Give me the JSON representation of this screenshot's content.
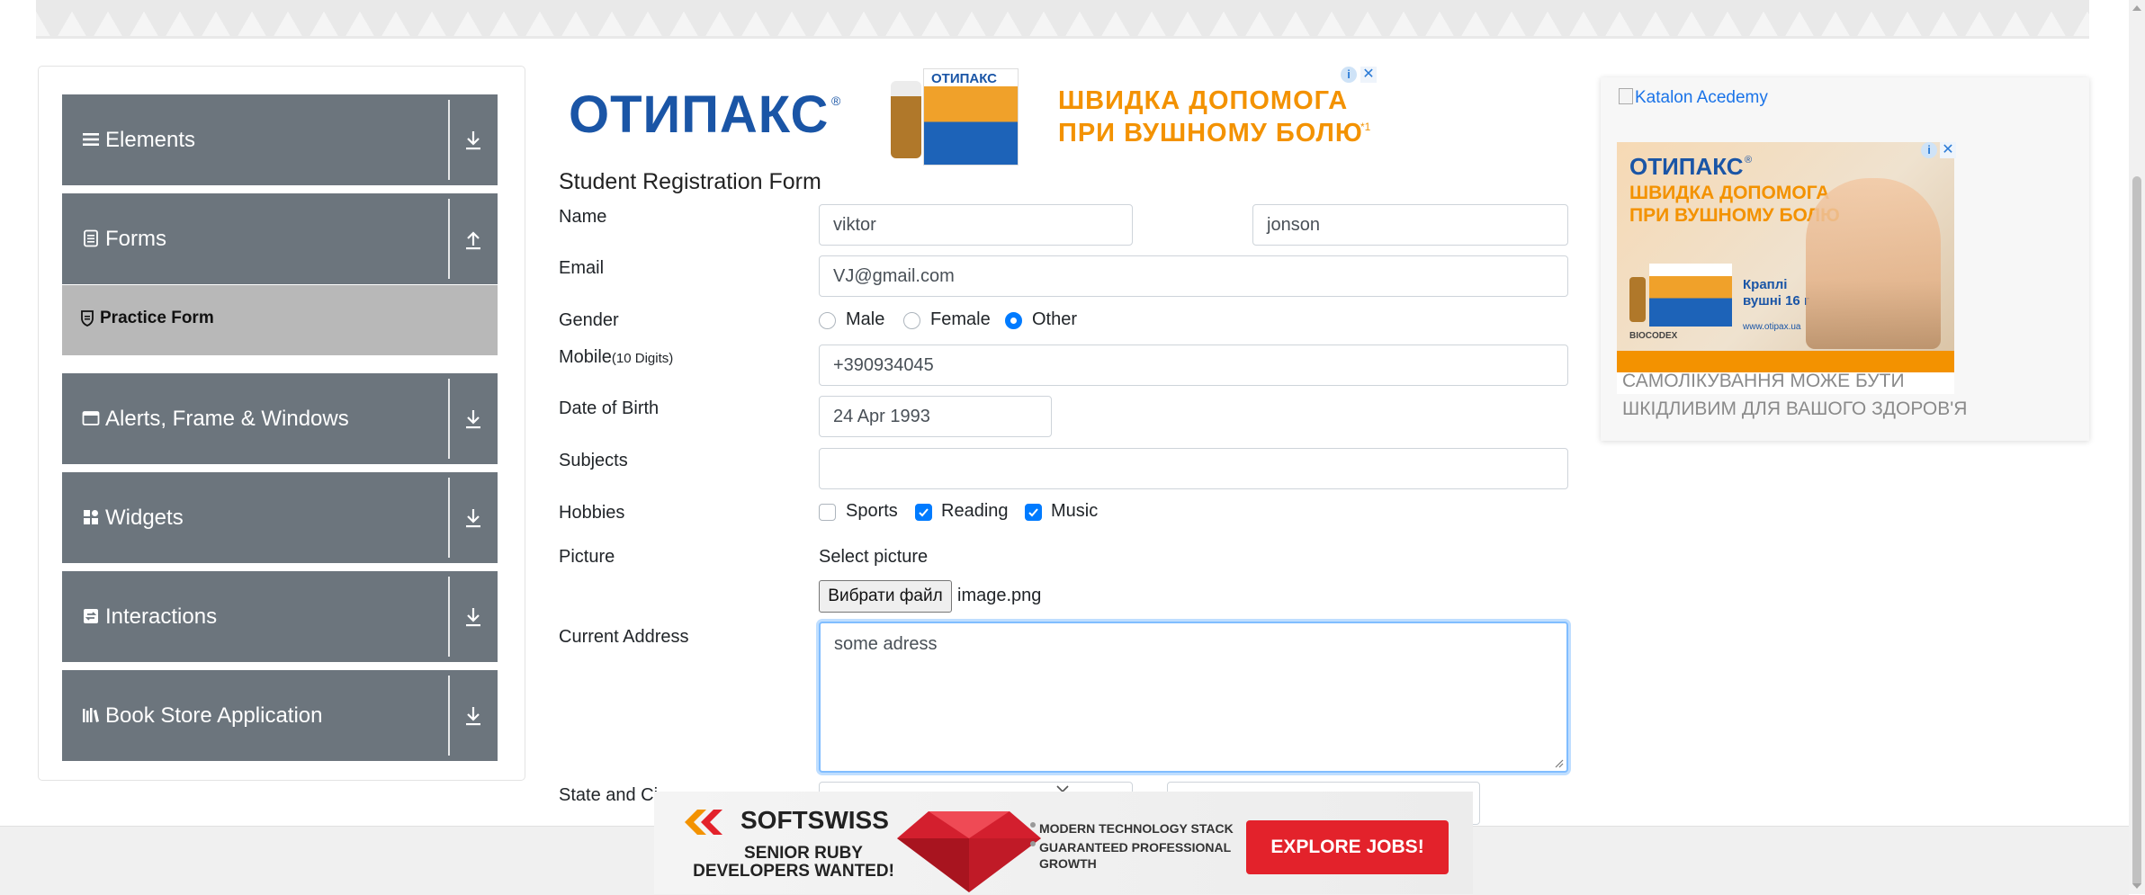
{
  "sidebar": {
    "groups": [
      {
        "label": "Elements",
        "icon": "menu-icon"
      },
      {
        "label": "Forms",
        "icon": "document-icon",
        "expanded": true
      },
      {
        "label": "Alerts, Frame & Windows",
        "icon": "window-icon"
      },
      {
        "label": "Widgets",
        "icon": "widgets-icon"
      },
      {
        "label": "Interactions",
        "icon": "interactions-icon"
      },
      {
        "label": "Book Store Application",
        "icon": "books-icon"
      }
    ],
    "active_item": {
      "label": "Practice Form",
      "icon": "shield-icon"
    }
  },
  "ad_top": {
    "brand": "ОТИПАКС",
    "trademark": "®",
    "product_label": "ОТИПАКС",
    "slogan_line1": "ШВИДКА ДОПОМОГА",
    "slogan_line2": "ПРИ ВУШНОМУ БОЛЮ",
    "slogan_mark": "*1"
  },
  "form": {
    "title": "Student Registration Form",
    "name_label": "Name",
    "first_name": "viktor",
    "last_name": "jonson",
    "email_label": "Email",
    "email": "VJ@gmail.com",
    "gender_label": "Gender",
    "genders": [
      "Male",
      "Female",
      "Other"
    ],
    "gender_selected": "Other",
    "mobile_label": "Mobile",
    "mobile_hint": "(10 Digits)",
    "mobile": "+390934045",
    "dob_label": "Date of Birth",
    "dob": "24 Apr 1993",
    "subjects_label": "Subjects",
    "subjects": "",
    "hobbies_label": "Hobbies",
    "hobbies": [
      {
        "label": "Sports",
        "checked": false
      },
      {
        "label": "Reading",
        "checked": true
      },
      {
        "label": "Music",
        "checked": true
      }
    ],
    "picture_label": "Picture",
    "select_picture": "Select picture",
    "file_button": "Вибрати файл",
    "file_name": "image.png",
    "address_label": "Current Address",
    "address": "some adress",
    "state_city_label": "State and Ci"
  },
  "right_ad": {
    "broken_image_alt": "Katalon Acedemy",
    "brand": "ОТИПАКС",
    "trademark": "®",
    "slogan_line1": "ШВИДКА ДОПОМОГА",
    "slogan_line2": "ПРИ ВУШНОМУ БОЛЮ",
    "product_line1": "Краплі",
    "product_line2": "вушні 16 г",
    "site": "www.otipax.ua",
    "company": "BIOCODEX",
    "warning_line1": "САМОЛІКУВАННЯ МОЖЕ БУТИ",
    "warning_line2": "ШКІДЛИВИМ ДЛЯ ВАШОГО ЗДОРОВ'Я"
  },
  "bottom_ad": {
    "brand": "SOFTSWISS",
    "tagline_line1": "SENIOR RUBY",
    "tagline_line2": "DEVELOPERS WANTED!",
    "bullet1": "MODERN TECHNOLOGY STACK",
    "bullet2_line1": "GUARANTEED PROFESSIONAL",
    "bullet2_line2": "GROWTH",
    "cta": "EXPLORE JOBS!"
  },
  "colors": {
    "sidebar_group": "#6c757d",
    "sidebar_active": "#b8b8b8",
    "accent": "#007bff",
    "ad_orange": "#f39200",
    "ad_blue": "#1a55a6",
    "cta_red": "#e3222b"
  }
}
